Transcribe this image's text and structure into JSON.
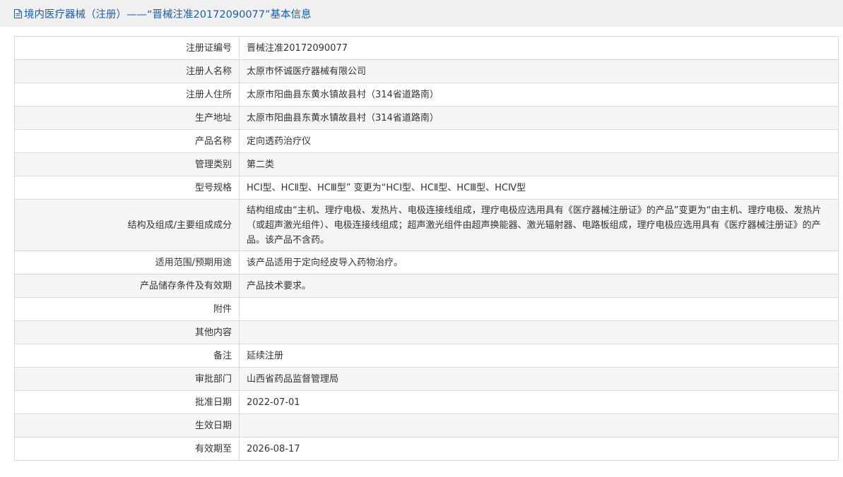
{
  "header": {
    "title": "境内医疗器械（注册）——“晋械注准20172090077”基本信息"
  },
  "rows": [
    {
      "label": "注册证编号",
      "value": "晋械注准20172090077"
    },
    {
      "label": "注册人名称",
      "value": "太原市怀诚医疗器械有限公司"
    },
    {
      "label": "注册人住所",
      "value": "太原市阳曲县东黄水镇故县村（314省道路南）"
    },
    {
      "label": "生产地址",
      "value": "太原市阳曲县东黄水镇故县村（314省道路南）"
    },
    {
      "label": "产品名称",
      "value": "定向透药治疗仪"
    },
    {
      "label": "管理类别",
      "value": "第二类"
    },
    {
      "label": "型号规格",
      "value": "HCⅠ型、HCⅡ型、HCⅢ型” 变更为“HCⅠ型、HCⅡ型、HCⅢ型、HCⅣ型"
    },
    {
      "label": "结构及组成/主要组成成分",
      "value": "结构组成由“主机、理疗电极、发热片、电极连接线组成，理疗电极应选用具有《医疗器械注册证》的产品”变更为“由主机、理疗电极、发热片（或超声激光组件）、电极连接线组成；超声激光组件由超声换能器、激光辐射器、电路板组成，理疗电极应选用具有《医疗器械注册证》的产品。该产品不含药。"
    },
    {
      "label": "适用范围/预期用途",
      "value": "该产品适用于定向经皮导入药物治疗。"
    },
    {
      "label": "产品储存条件及有效期",
      "value": "产品技术要求。"
    },
    {
      "label": "附件",
      "value": ""
    },
    {
      "label": "其他内容",
      "value": ""
    },
    {
      "label": "备注",
      "value": "延续注册"
    },
    {
      "label": "审批部门",
      "value": "山西省药品监督管理局"
    },
    {
      "label": "批准日期",
      "value": "2022-07-01"
    },
    {
      "label": "生效日期",
      "value": ""
    },
    {
      "label": "有效期至",
      "value": "2026-08-17"
    }
  ]
}
